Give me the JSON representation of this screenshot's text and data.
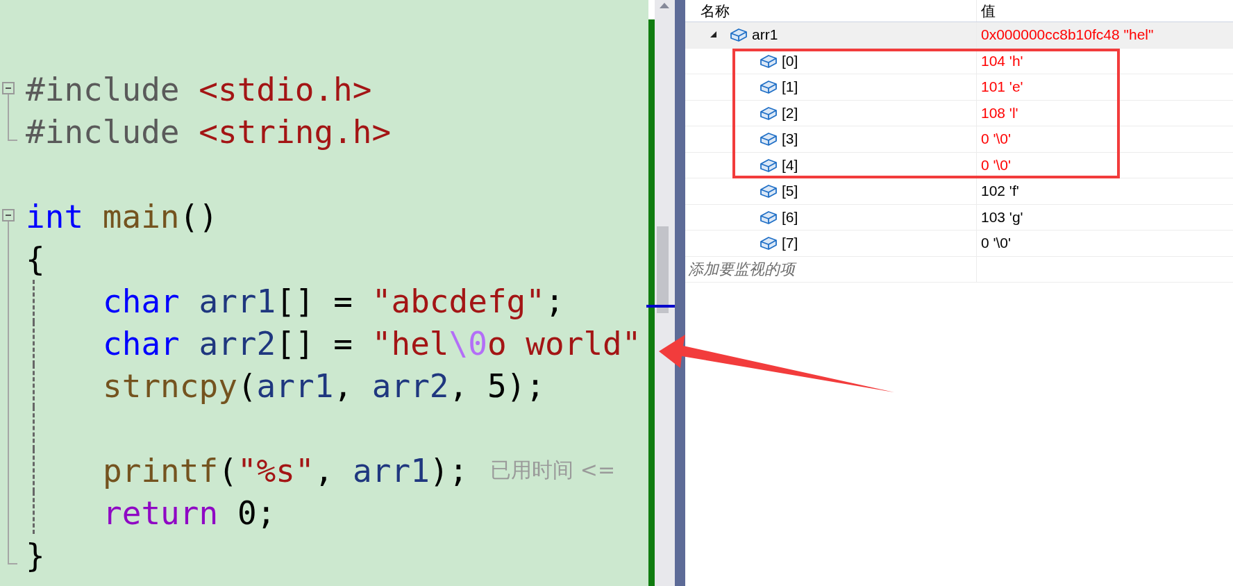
{
  "editor": {
    "lines": [
      {
        "kind": "fold-start",
        "tokens": [
          {
            "kind": "preproc",
            "text": "#include "
          },
          {
            "kind": "include",
            "text": "<stdio.h>"
          }
        ]
      },
      {
        "kind": "fold-end",
        "tokens": [
          {
            "kind": "preproc",
            "text": "#include "
          },
          {
            "kind": "include",
            "text": "<string.h>"
          }
        ]
      },
      {
        "kind": "blank"
      },
      {
        "kind": "fold-start",
        "tokens": [
          {
            "kind": "keyword",
            "text": "int "
          },
          {
            "kind": "function",
            "text": "main"
          },
          {
            "kind": "punct",
            "text": "()"
          }
        ]
      },
      {
        "kind": "body",
        "tokens": [
          {
            "kind": "punct",
            "text": "{"
          }
        ]
      },
      {
        "kind": "nested",
        "tokens": [
          {
            "kind": "keyword",
            "text": "char "
          },
          {
            "kind": "variable",
            "text": "arr1"
          },
          {
            "kind": "punct",
            "text": "[] = "
          },
          {
            "kind": "string",
            "text": "\"abcdefg\""
          },
          {
            "kind": "punct",
            "text": ";"
          }
        ]
      },
      {
        "kind": "nested",
        "tokens": [
          {
            "kind": "keyword",
            "text": "char "
          },
          {
            "kind": "variable",
            "text": "arr2"
          },
          {
            "kind": "punct",
            "text": "[] = "
          },
          {
            "kind": "string",
            "text": "\"hel"
          },
          {
            "kind": "escape",
            "text": "\\0"
          },
          {
            "kind": "string",
            "text": "o world\""
          }
        ]
      },
      {
        "kind": "nested",
        "tokens": [
          {
            "kind": "function",
            "text": "strncpy"
          },
          {
            "kind": "punct",
            "text": "("
          },
          {
            "kind": "variable",
            "text": "arr1"
          },
          {
            "kind": "punct",
            "text": ", "
          },
          {
            "kind": "variable",
            "text": "arr2"
          },
          {
            "kind": "punct",
            "text": ", 5);"
          }
        ]
      },
      {
        "kind": "nested"
      },
      {
        "kind": "nested",
        "tokens": [
          {
            "kind": "function",
            "text": "printf"
          },
          {
            "kind": "punct",
            "text": "("
          },
          {
            "kind": "string",
            "text": "\"%s\""
          },
          {
            "kind": "punct",
            "text": ", "
          },
          {
            "kind": "variable",
            "text": "arr1"
          },
          {
            "kind": "punct",
            "text": ");"
          }
        ],
        "hint": "已用时间 <="
      },
      {
        "kind": "nested",
        "tokens": [
          {
            "kind": "control",
            "text": "return "
          },
          {
            "kind": "punct",
            "text": "0;"
          }
        ]
      },
      {
        "kind": "fold-end",
        "tokens": [
          {
            "kind": "punct",
            "text": "}"
          }
        ]
      }
    ]
  },
  "watch": {
    "columns": [
      "名称",
      "值"
    ],
    "items": [
      {
        "name": "arr1",
        "value": "0x000000cc8b10fc48 \"hel\"",
        "changed": true,
        "expanded": true,
        "children": [
          {
            "name": "[0]",
            "value": "104 'h'",
            "changed": true
          },
          {
            "name": "[1]",
            "value": "101 'e'",
            "changed": true
          },
          {
            "name": "[2]",
            "value": "108 'l'",
            "changed": true
          },
          {
            "name": "[3]",
            "value": "0 '\\0'",
            "changed": true
          },
          {
            "name": "[4]",
            "value": "0 '\\0'",
            "changed": true
          },
          {
            "name": "[5]",
            "value": "102 'f'",
            "changed": false
          },
          {
            "name": "[6]",
            "value": "103 'g'",
            "changed": false
          },
          {
            "name": "[7]",
            "value": "0 '\\0'",
            "changed": false
          }
        ]
      }
    ],
    "add_item": {
      "placeholder": "添加要监视的项"
    }
  }
}
